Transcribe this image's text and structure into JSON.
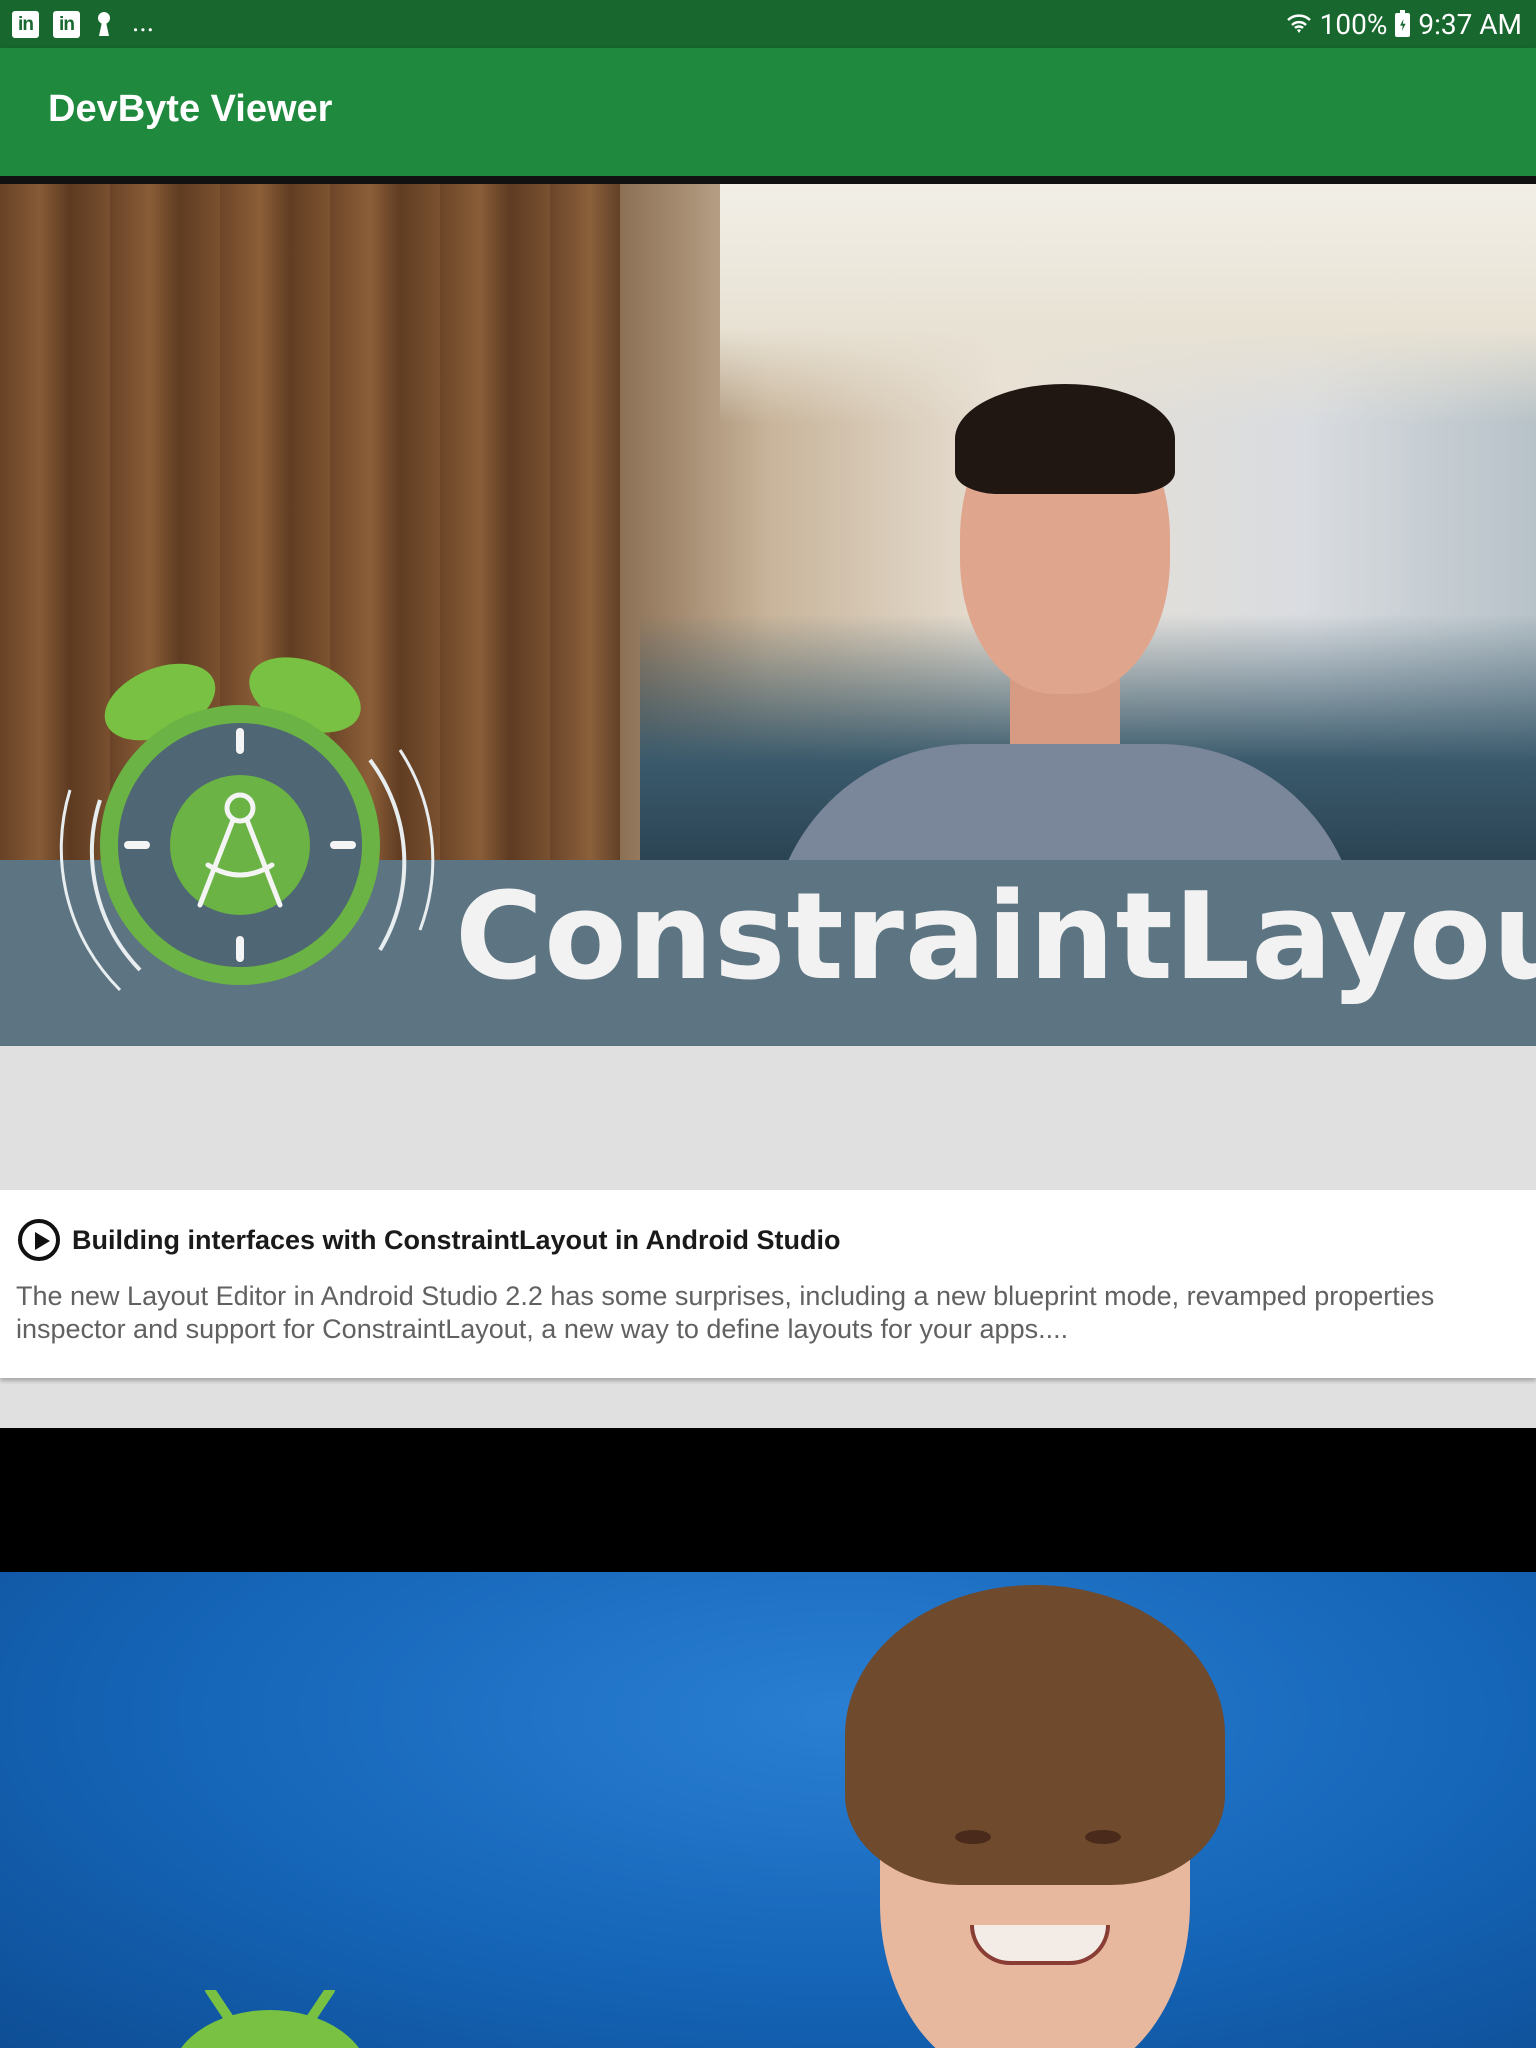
{
  "status_bar": {
    "notification_icons": [
      "linkedin-icon",
      "linkedin-icon",
      "keyhole-icon"
    ],
    "more_indicator": "...",
    "battery_percent": "100%",
    "time": "9:37 AM"
  },
  "app_bar": {
    "title": "DevByte Viewer",
    "color": "#1f8a3e"
  },
  "videos": [
    {
      "thumbnail_banner_text": "ConstraintLayout",
      "title": "Building interfaces with ConstraintLayout in Android Studio",
      "description": "The new Layout Editor in Android Studio 2.2 has some surprises, including a new blueprint mode, revamped properties inspector and support for ConstraintLayout, a new way to define layouts for your apps...."
    },
    {
      "thumbnail_banner_text": ""
    }
  ],
  "colors": {
    "status_bar": "#17672e",
    "app_bar": "#1f8a3e",
    "background": "#e0e0e0"
  }
}
